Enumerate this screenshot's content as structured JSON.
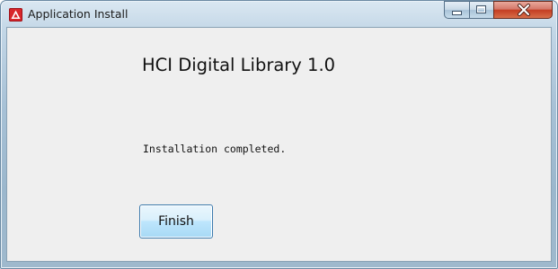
{
  "window": {
    "title": "Application Install",
    "icon": "adobe-air-icon",
    "caption_buttons": [
      "minimize-icon",
      "maximize-icon",
      "close-icon"
    ]
  },
  "main": {
    "app_name": "HCI Digital Library 1.0",
    "status": "Installation completed.",
    "finish_label": "Finish"
  },
  "colors": {
    "close_button": "#c43d22",
    "finish_border": "#3d7bad",
    "client_bg": "#efefef"
  }
}
